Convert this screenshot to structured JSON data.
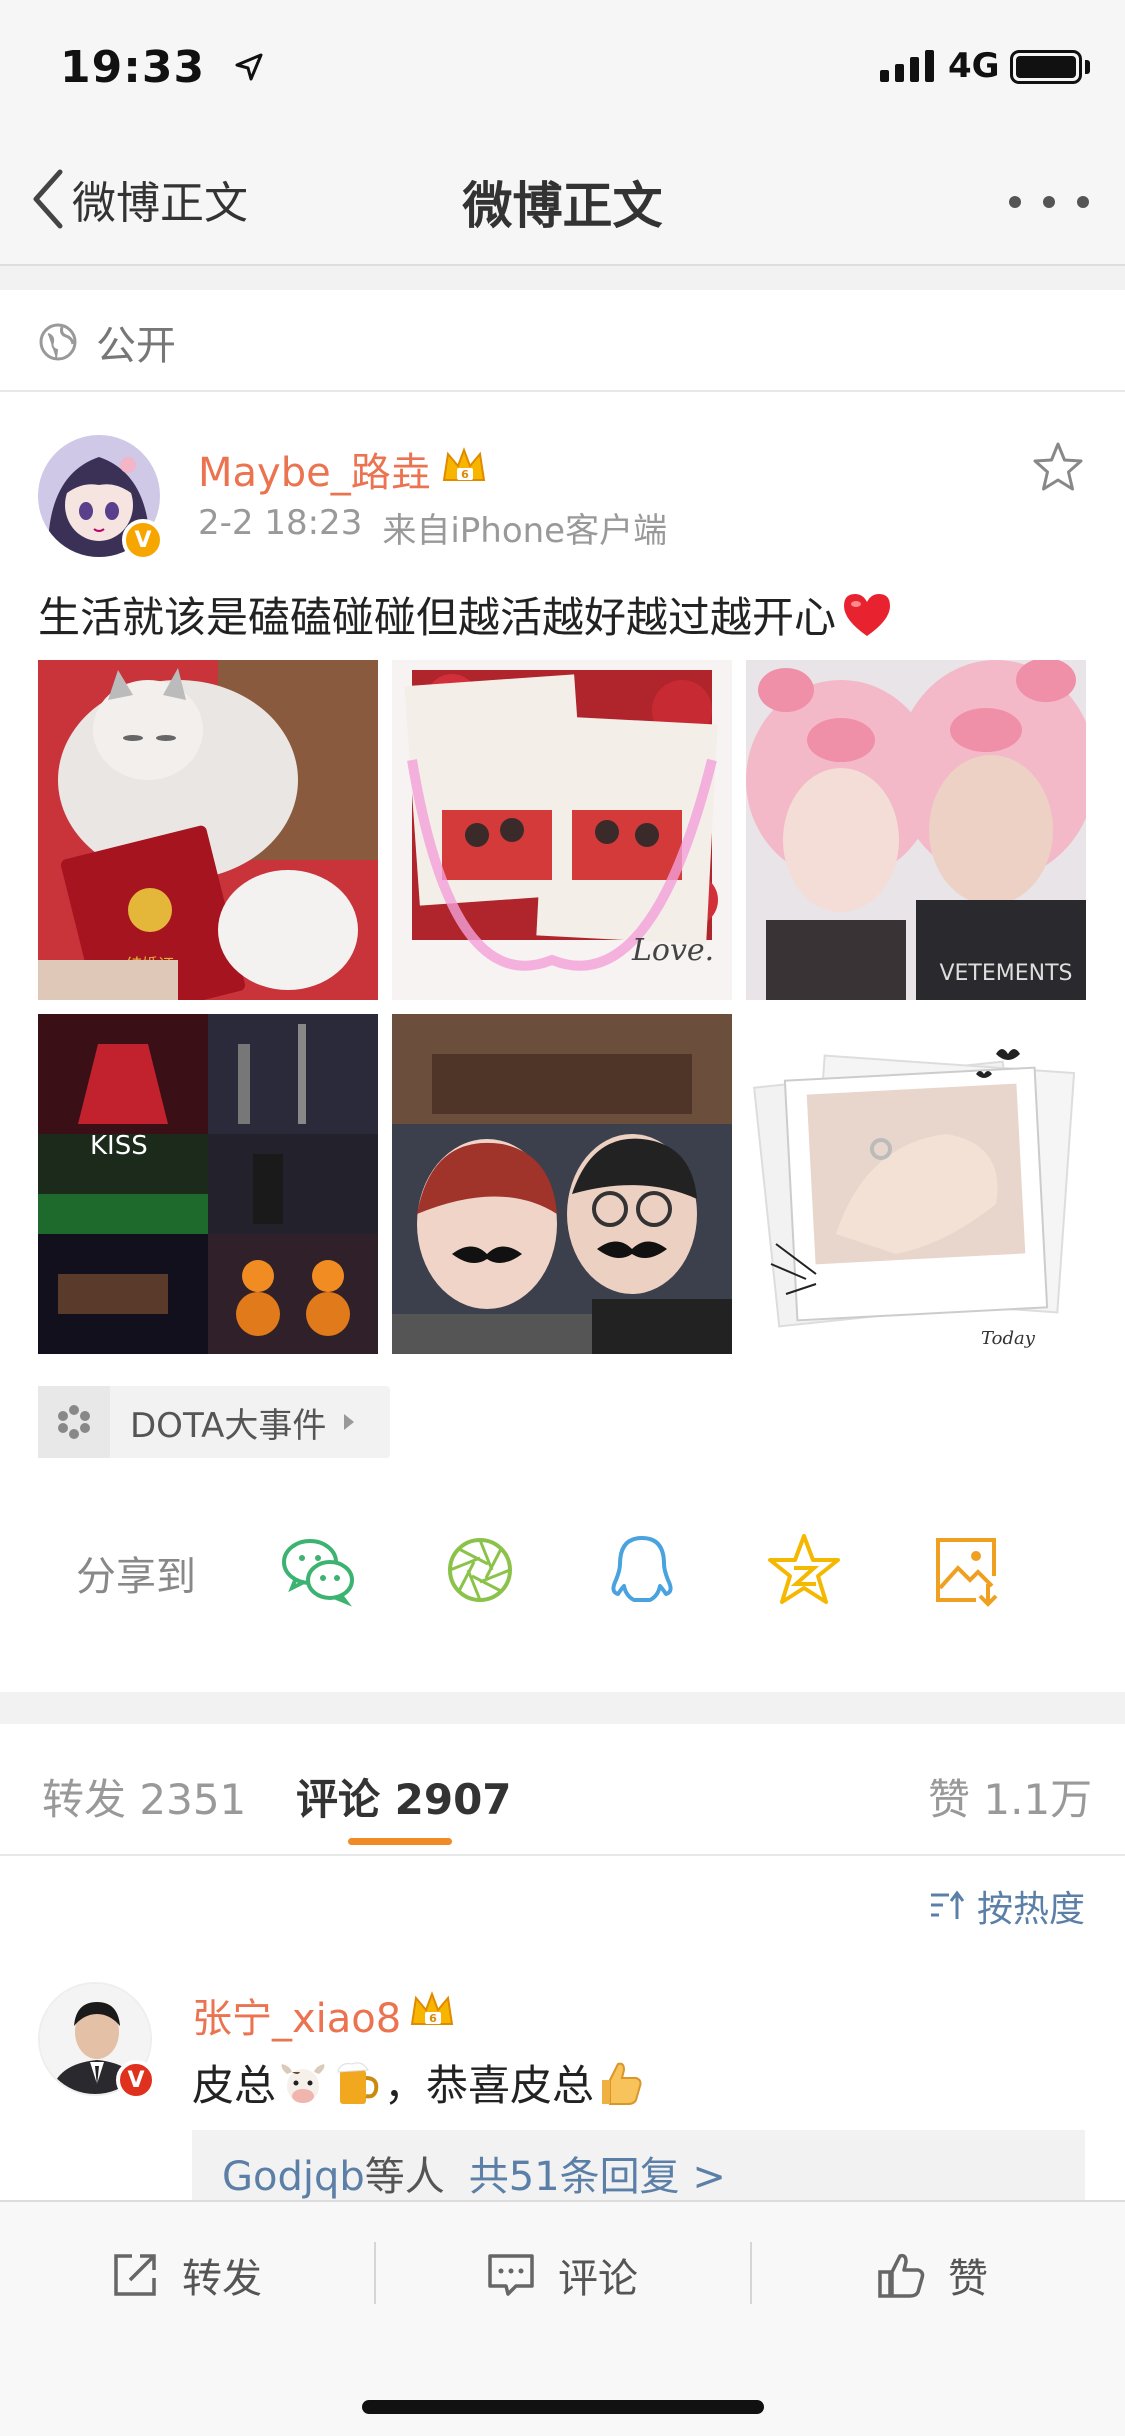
{
  "status_bar": {
    "time": "19:33",
    "network": "4G"
  },
  "nav": {
    "back_label": "微博正文",
    "title": "微博正文"
  },
  "visibility": {
    "label": "公开"
  },
  "post": {
    "username": "Maybe_路垚",
    "badge": "V",
    "time": "2-2 18:23",
    "source": "来自iPhone客户端",
    "text": "生活就该是磕磕碰碰但越活越好越过越开心",
    "photos": [
      {
        "name": "cat-marriage-certificate-photo",
        "overlay_text": ""
      },
      {
        "name": "couple-certificate-photos",
        "overlay_text": "Love."
      },
      {
        "name": "pig-hat-selfie-photo",
        "overlay_text": ""
      },
      {
        "name": "kiss-collage-photo",
        "overlay_text": "KISS"
      },
      {
        "name": "mustache-selfie-photo",
        "overlay_text": ""
      },
      {
        "name": "ring-polaroid-photo",
        "overlay_text": "Today"
      }
    ],
    "topic": "DOTA大事件"
  },
  "share": {
    "label": "分享到",
    "targets": [
      "wechat",
      "moments",
      "qq",
      "qzone",
      "save-image"
    ]
  },
  "tabs": [
    {
      "label": "转发",
      "count": "2351"
    },
    {
      "label": "评论",
      "count": "2907"
    },
    {
      "label": "赞",
      "count": "1.1万"
    }
  ],
  "sort": {
    "label": "按热度"
  },
  "comment": {
    "username": "张宁_xiao8",
    "badge": "V",
    "text_before": "皮总",
    "text_after": "，恭喜皮总",
    "reply_users": "Godjqb",
    "reply_mid": "等人",
    "reply_link": "共51条回复 >"
  },
  "toolbar": {
    "repost": "转发",
    "comment": "评论",
    "like": "赞"
  },
  "colors": {
    "accent": "#f08a24",
    "username": "#eb7350",
    "link": "#5b7fa6"
  }
}
